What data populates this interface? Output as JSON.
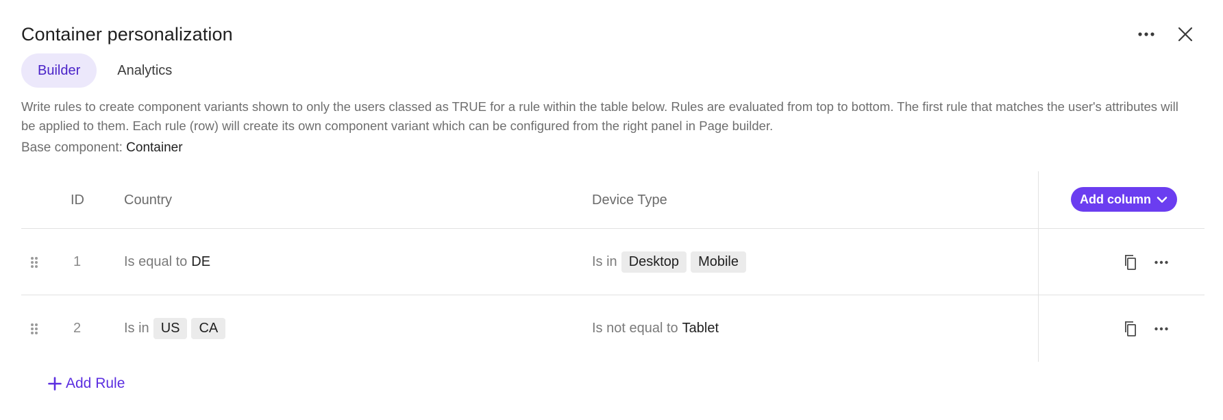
{
  "header": {
    "title": "Container personalization"
  },
  "tabs": [
    {
      "label": "Builder",
      "active": true
    },
    {
      "label": "Analytics",
      "active": false
    }
  ],
  "description": "Write rules to create component variants shown to only the users classed as TRUE for a rule within the table below. Rules are evaluated from top to bottom. The first rule that matches the user's attributes will be applied to them. Each rule (row) will create its own component variant which can be configured from the right panel in Page builder.",
  "base_component": {
    "label": "Base component:",
    "value": "Container"
  },
  "table": {
    "columns": {
      "id": "ID",
      "country": "Country",
      "device": "Device Type"
    },
    "add_column_label": "Add column",
    "rows": [
      {
        "id": "1",
        "country": {
          "operator": "Is equal to",
          "value": "DE"
        },
        "device": {
          "operator": "Is in",
          "chips": [
            "Desktop",
            "Mobile"
          ]
        }
      },
      {
        "id": "2",
        "country": {
          "operator": "Is in",
          "chips": [
            "US",
            "CA"
          ]
        },
        "device": {
          "operator": "Is not equal to",
          "value": "Tablet"
        }
      }
    ]
  },
  "add_rule_label": "Add Rule",
  "colors": {
    "accent": "#6b3df0",
    "active_tab_bg": "#ece8fb",
    "active_tab_text": "#4a23c8",
    "chip_bg": "#ebebeb"
  },
  "icons": {
    "more": "more-horizontal-icon",
    "close": "close-icon",
    "chevron": "chevron-down-icon",
    "drag": "drag-handle-icon",
    "copy": "copy-icon",
    "add": "plus-icon"
  }
}
